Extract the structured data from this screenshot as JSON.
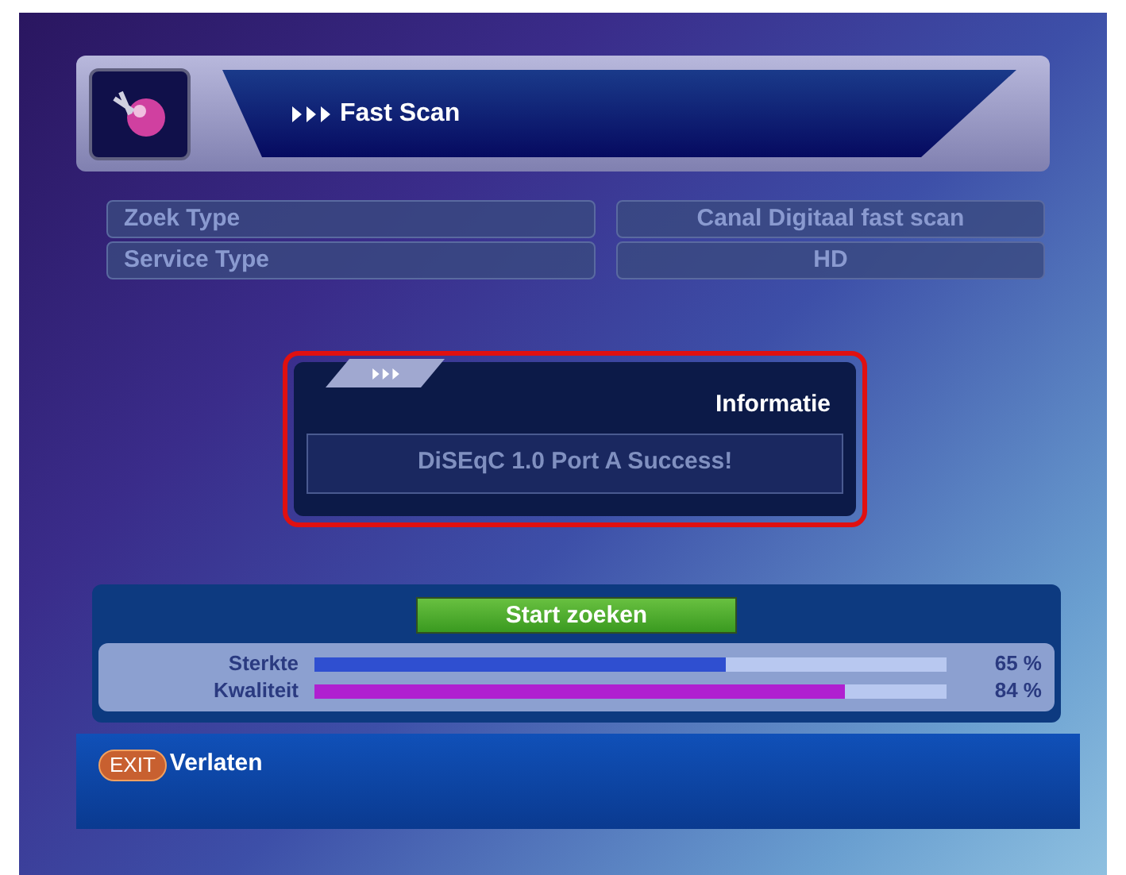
{
  "header": {
    "title": "Fast Scan"
  },
  "settings": [
    {
      "label": "Zoek Type",
      "value": "Canal Digitaal fast scan"
    },
    {
      "label": "Service Type",
      "value": "HD"
    }
  ],
  "dialog": {
    "title": "Informatie",
    "message": "DiSEqC 1.0 Port A Success!",
    "highlighted": true
  },
  "scan": {
    "button": "Start zoeken",
    "meters": [
      {
        "label": "Sterkte",
        "level": 0.65,
        "reading": "65 %",
        "color": "#2f4fd0"
      },
      {
        "label": "Kwaliteit",
        "level": 0.84,
        "reading": "84 %",
        "color": "#b020d0"
      }
    ]
  },
  "footer": {
    "key": "EXIT",
    "label": "Verlaten"
  }
}
